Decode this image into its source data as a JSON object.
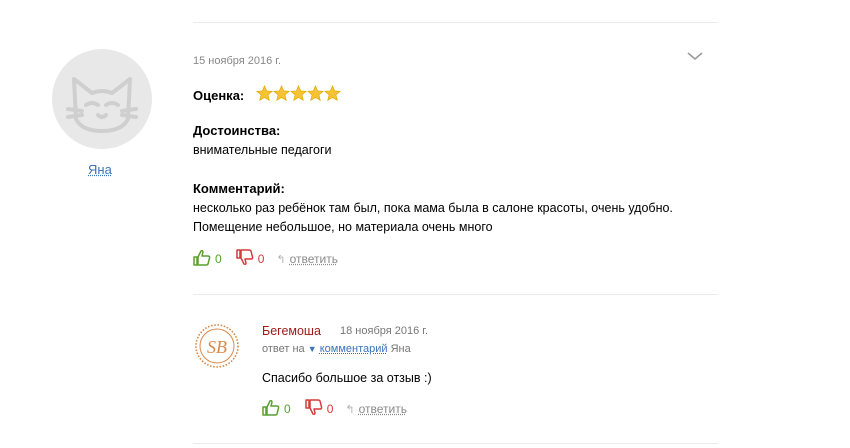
{
  "review": {
    "author": "Яна",
    "date": "15 ноября 2016 г.",
    "rating_label": "Оценка:",
    "rating": 5,
    "rating_max": 5,
    "pros_label": "Достоинства:",
    "pros_text": "внимательные педагоги",
    "comment_label": "Комментарий:",
    "comment_line1": "несколько раз ребёнок там был, пока мама была в салоне красоты, очень удобно.",
    "comment_line2": "Помещение небольшое, но материала очень много",
    "likes": "0",
    "dislikes": "0",
    "reply_label": "ответить"
  },
  "reply": {
    "author": "Бегемоша",
    "date": "18 ноября 2016 г.",
    "meta_prefix": "ответ на",
    "meta_link": "комментарий",
    "meta_suffix": "Яна",
    "text": "Спасибо большое за отзыв :)",
    "likes": "0",
    "dislikes": "0",
    "reply_label": "ответить",
    "logo_text": "SB"
  },
  "colors": {
    "star": "#f5c335",
    "like": "#5aa02c",
    "dislike": "#d63a3a",
    "link": "#3b73b9",
    "reply_author": "#a11a1a",
    "logo_ring": "#d9894a"
  },
  "icons": {
    "avatar": "cat-avatar-icon",
    "expand": "chevron-down-icon",
    "like": "thumbs-up-icon",
    "dislike": "thumbs-down-icon",
    "reply": "reply-arrow-icon",
    "meta_arrow": "triangle-down-icon"
  }
}
